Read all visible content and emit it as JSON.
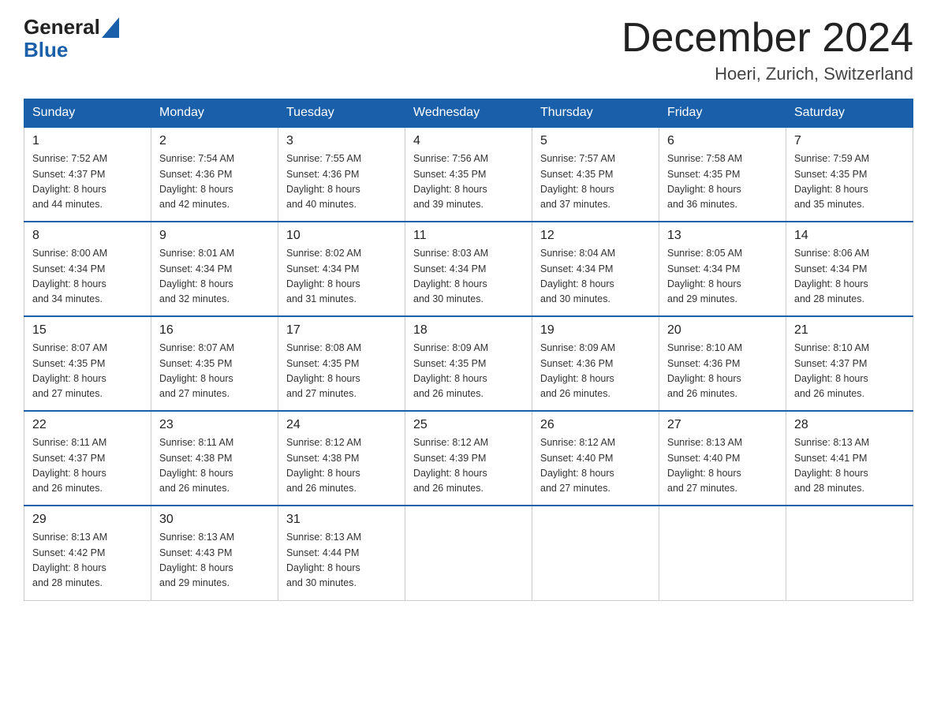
{
  "logo": {
    "general": "General",
    "blue": "Blue"
  },
  "title": "December 2024",
  "location": "Hoeri, Zurich, Switzerland",
  "days_of_week": [
    "Sunday",
    "Monday",
    "Tuesday",
    "Wednesday",
    "Thursday",
    "Friday",
    "Saturday"
  ],
  "weeks": [
    [
      {
        "day": "1",
        "sunrise": "7:52 AM",
        "sunset": "4:37 PM",
        "daylight": "8 hours and 44 minutes."
      },
      {
        "day": "2",
        "sunrise": "7:54 AM",
        "sunset": "4:36 PM",
        "daylight": "8 hours and 42 minutes."
      },
      {
        "day": "3",
        "sunrise": "7:55 AM",
        "sunset": "4:36 PM",
        "daylight": "8 hours and 40 minutes."
      },
      {
        "day": "4",
        "sunrise": "7:56 AM",
        "sunset": "4:35 PM",
        "daylight": "8 hours and 39 minutes."
      },
      {
        "day": "5",
        "sunrise": "7:57 AM",
        "sunset": "4:35 PM",
        "daylight": "8 hours and 37 minutes."
      },
      {
        "day": "6",
        "sunrise": "7:58 AM",
        "sunset": "4:35 PM",
        "daylight": "8 hours and 36 minutes."
      },
      {
        "day": "7",
        "sunrise": "7:59 AM",
        "sunset": "4:35 PM",
        "daylight": "8 hours and 35 minutes."
      }
    ],
    [
      {
        "day": "8",
        "sunrise": "8:00 AM",
        "sunset": "4:34 PM",
        "daylight": "8 hours and 34 minutes."
      },
      {
        "day": "9",
        "sunrise": "8:01 AM",
        "sunset": "4:34 PM",
        "daylight": "8 hours and 32 minutes."
      },
      {
        "day": "10",
        "sunrise": "8:02 AM",
        "sunset": "4:34 PM",
        "daylight": "8 hours and 31 minutes."
      },
      {
        "day": "11",
        "sunrise": "8:03 AM",
        "sunset": "4:34 PM",
        "daylight": "8 hours and 30 minutes."
      },
      {
        "day": "12",
        "sunrise": "8:04 AM",
        "sunset": "4:34 PM",
        "daylight": "8 hours and 30 minutes."
      },
      {
        "day": "13",
        "sunrise": "8:05 AM",
        "sunset": "4:34 PM",
        "daylight": "8 hours and 29 minutes."
      },
      {
        "day": "14",
        "sunrise": "8:06 AM",
        "sunset": "4:34 PM",
        "daylight": "8 hours and 28 minutes."
      }
    ],
    [
      {
        "day": "15",
        "sunrise": "8:07 AM",
        "sunset": "4:35 PM",
        "daylight": "8 hours and 27 minutes."
      },
      {
        "day": "16",
        "sunrise": "8:07 AM",
        "sunset": "4:35 PM",
        "daylight": "8 hours and 27 minutes."
      },
      {
        "day": "17",
        "sunrise": "8:08 AM",
        "sunset": "4:35 PM",
        "daylight": "8 hours and 27 minutes."
      },
      {
        "day": "18",
        "sunrise": "8:09 AM",
        "sunset": "4:35 PM",
        "daylight": "8 hours and 26 minutes."
      },
      {
        "day": "19",
        "sunrise": "8:09 AM",
        "sunset": "4:36 PM",
        "daylight": "8 hours and 26 minutes."
      },
      {
        "day": "20",
        "sunrise": "8:10 AM",
        "sunset": "4:36 PM",
        "daylight": "8 hours and 26 minutes."
      },
      {
        "day": "21",
        "sunrise": "8:10 AM",
        "sunset": "4:37 PM",
        "daylight": "8 hours and 26 minutes."
      }
    ],
    [
      {
        "day": "22",
        "sunrise": "8:11 AM",
        "sunset": "4:37 PM",
        "daylight": "8 hours and 26 minutes."
      },
      {
        "day": "23",
        "sunrise": "8:11 AM",
        "sunset": "4:38 PM",
        "daylight": "8 hours and 26 minutes."
      },
      {
        "day": "24",
        "sunrise": "8:12 AM",
        "sunset": "4:38 PM",
        "daylight": "8 hours and 26 minutes."
      },
      {
        "day": "25",
        "sunrise": "8:12 AM",
        "sunset": "4:39 PM",
        "daylight": "8 hours and 26 minutes."
      },
      {
        "day": "26",
        "sunrise": "8:12 AM",
        "sunset": "4:40 PM",
        "daylight": "8 hours and 27 minutes."
      },
      {
        "day": "27",
        "sunrise": "8:13 AM",
        "sunset": "4:40 PM",
        "daylight": "8 hours and 27 minutes."
      },
      {
        "day": "28",
        "sunrise": "8:13 AM",
        "sunset": "4:41 PM",
        "daylight": "8 hours and 28 minutes."
      }
    ],
    [
      {
        "day": "29",
        "sunrise": "8:13 AM",
        "sunset": "4:42 PM",
        "daylight": "8 hours and 28 minutes."
      },
      {
        "day": "30",
        "sunrise": "8:13 AM",
        "sunset": "4:43 PM",
        "daylight": "8 hours and 29 minutes."
      },
      {
        "day": "31",
        "sunrise": "8:13 AM",
        "sunset": "4:44 PM",
        "daylight": "8 hours and 30 minutes."
      },
      null,
      null,
      null,
      null
    ]
  ],
  "labels": {
    "sunrise": "Sunrise:",
    "sunset": "Sunset:",
    "daylight": "Daylight:"
  }
}
